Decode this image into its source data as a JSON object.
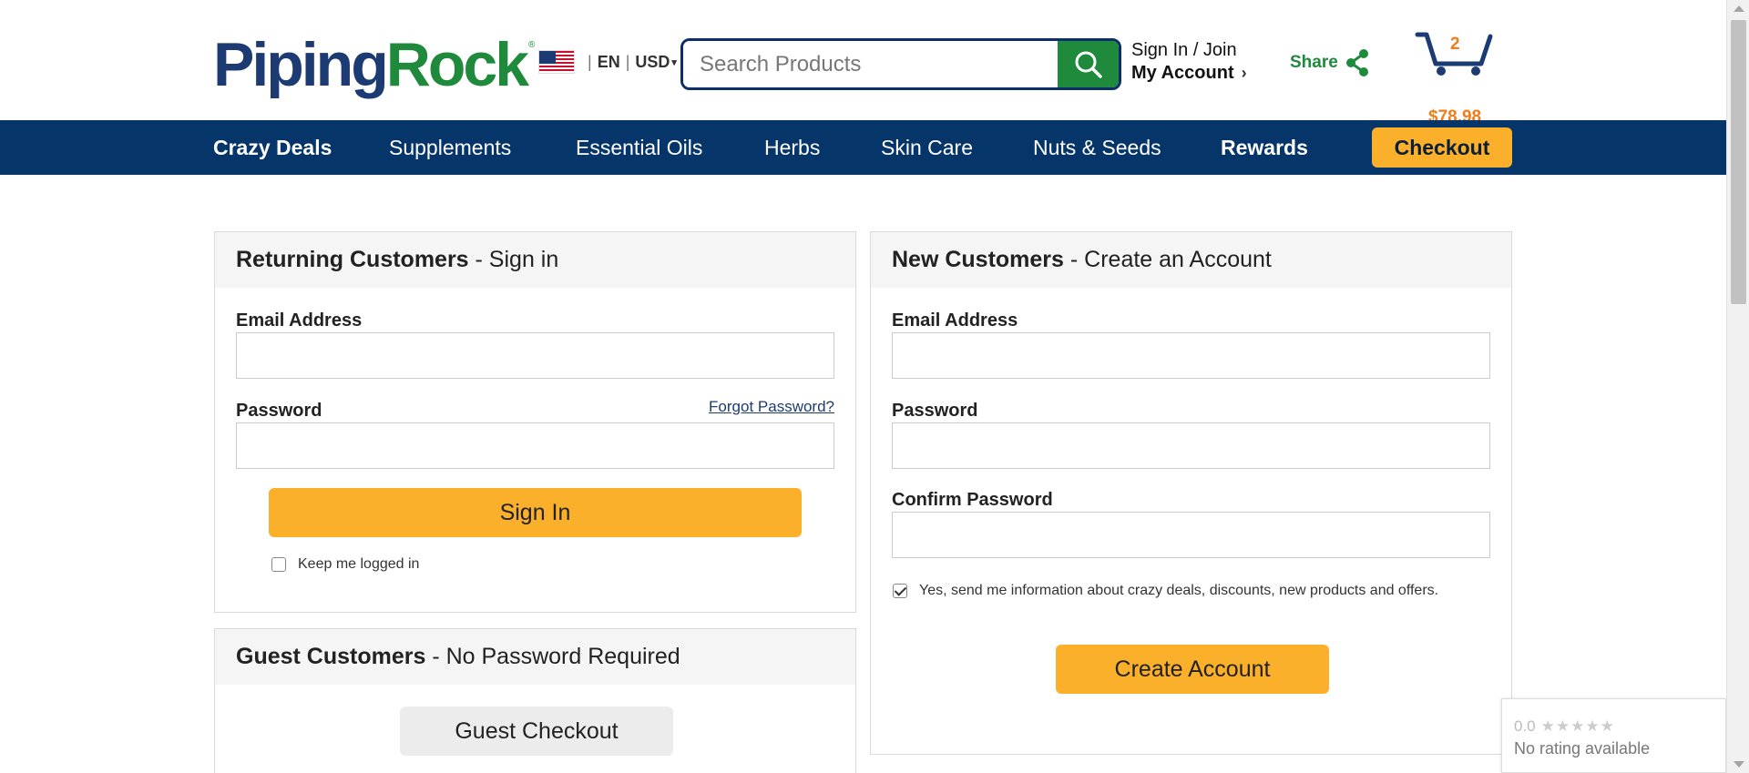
{
  "header": {
    "logo": {
      "part1": "Piping",
      "part2": "Rock",
      "reg": "®"
    },
    "locale": {
      "language": "EN",
      "currency": "USD",
      "separator": "|"
    },
    "search": {
      "placeholder": "Search Products"
    },
    "account": {
      "signin_join": "Sign In / Join",
      "my_account": "My Account"
    },
    "share_label": "Share",
    "cart": {
      "count": "2",
      "total": "$78.98"
    }
  },
  "nav": {
    "items": [
      "Crazy Deals",
      "Supplements",
      "Essential Oils",
      "Herbs",
      "Skin Care",
      "Nuts & Seeds",
      "Rewards"
    ],
    "checkout_label": "Checkout"
  },
  "returning": {
    "title_bold": "Returning Customers",
    "title_rest": " - Sign in",
    "email_label": "Email Address",
    "password_label": "Password",
    "forgot_label": "Forgot Password?",
    "signin_button": "Sign In",
    "keep_logged_label": "Keep me logged in",
    "keep_logged_checked": false
  },
  "guest": {
    "title_bold": "Guest Customers",
    "title_rest": " - No Password Required",
    "button": "Guest Checkout"
  },
  "new_customers": {
    "title_bold": "New Customers",
    "title_rest": " - Create an Account",
    "email_label": "Email Address",
    "password_label": "Password",
    "confirm_label": "Confirm Password",
    "optin_label": "Yes, send me information about crazy deals, discounts, new products and offers.",
    "optin_checked": true,
    "create_button": "Create Account"
  },
  "rating_widget": {
    "score": "0.0",
    "stars": "★★★★★",
    "text": "No rating available"
  },
  "colors": {
    "navy": "#06356a",
    "brand_blue": "#1d3b73",
    "brand_green": "#1f8a3c",
    "accent_yellow": "#fbb02c",
    "cart_orange": "#f07c1a"
  }
}
